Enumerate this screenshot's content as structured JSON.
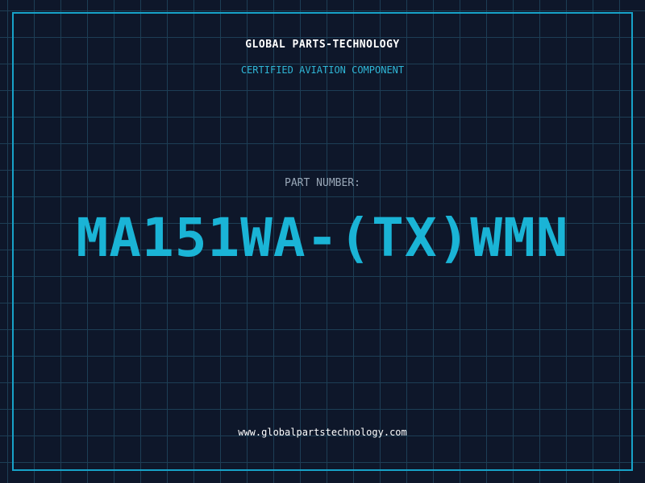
{
  "header": {
    "brand": "GLOBAL PARTS-TECHNOLOGY",
    "subtitle": "CERTIFIED AVIATION COMPONENT"
  },
  "part": {
    "label": "PART NUMBER:",
    "number": "MA151WA-(TX)WMN"
  },
  "footer": {
    "website": "www.globalpartstechnology.com"
  },
  "colors": {
    "background": "#0e172a",
    "grid": "#1d3e55",
    "accent": "#1ab4d6",
    "frame": "#17a2c8"
  }
}
